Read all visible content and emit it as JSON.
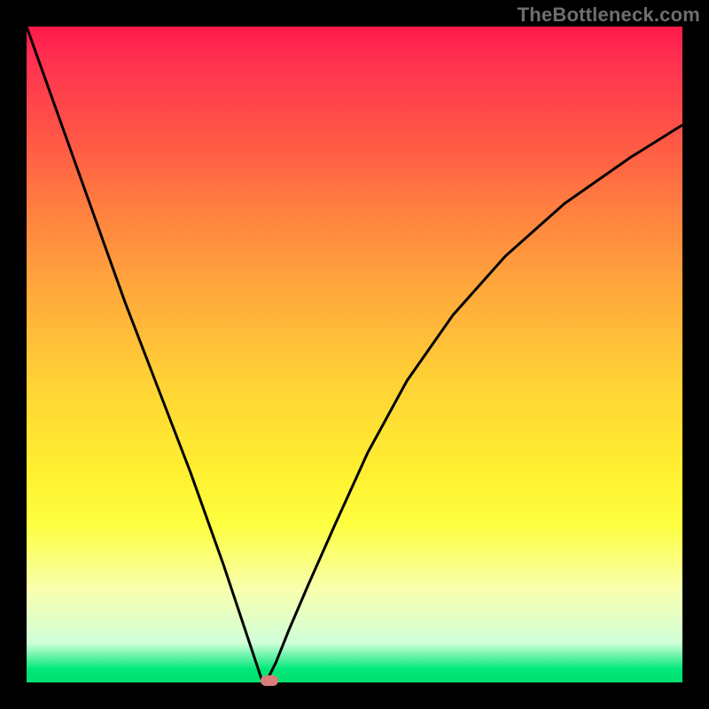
{
  "watermark": "TheBottleneck.com",
  "colors": {
    "background": "#000000",
    "gradient_top": "#ff1a4a",
    "gradient_bottom": "#00e070",
    "curve": "#000000",
    "marker": "#d87c7c"
  },
  "chart_data": {
    "type": "line",
    "title": "",
    "xlabel": "",
    "ylabel": "",
    "domain_x": [
      0,
      100
    ],
    "ylim": [
      0,
      100
    ],
    "optimum_x": 36,
    "marker": {
      "x": 37,
      "y": 0
    },
    "series": [
      {
        "name": "bottleneck-curve",
        "x": [
          0,
          5,
          10,
          15,
          20,
          25,
          30,
          33,
          35,
          36,
          37,
          38,
          40,
          43,
          47,
          52,
          58,
          65,
          73,
          82,
          92,
          100
        ],
        "values": [
          100,
          86,
          72,
          58,
          45,
          32,
          18,
          9,
          3,
          0,
          1,
          3,
          8,
          15,
          24,
          35,
          46,
          56,
          65,
          73,
          80,
          85
        ]
      }
    ],
    "annotations": []
  }
}
